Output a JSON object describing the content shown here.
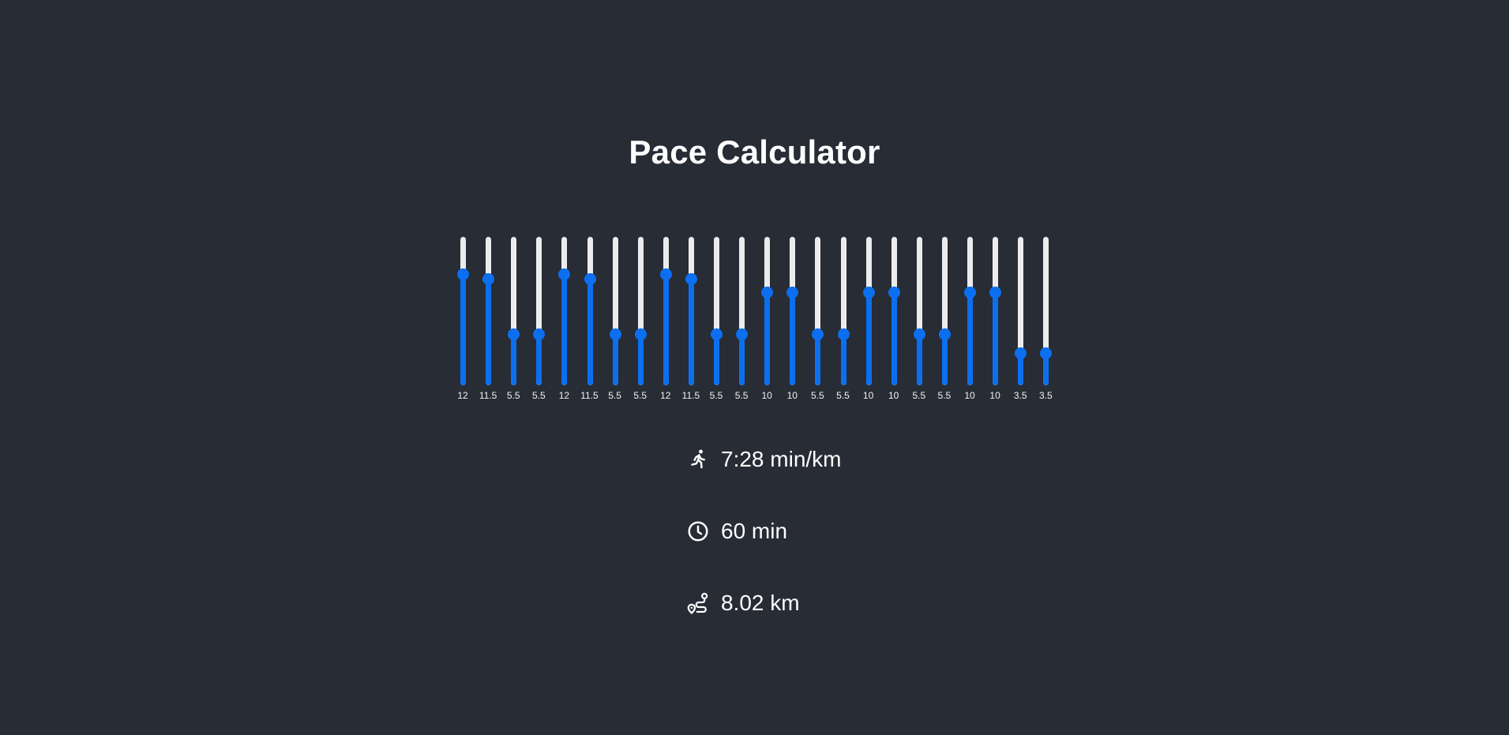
{
  "title": "Pace Calculator",
  "slider_range": [
    0,
    16
  ],
  "sliders": [
    {
      "label": "12",
      "value": 12
    },
    {
      "label": "11.5",
      "value": 11.5
    },
    {
      "label": "5.5",
      "value": 5.5
    },
    {
      "label": "5.5",
      "value": 5.5
    },
    {
      "label": "12",
      "value": 12
    },
    {
      "label": "11.5",
      "value": 11.5
    },
    {
      "label": "5.5",
      "value": 5.5
    },
    {
      "label": "5.5",
      "value": 5.5
    },
    {
      "label": "12",
      "value": 12
    },
    {
      "label": "11.5",
      "value": 11.5
    },
    {
      "label": "5.5",
      "value": 5.5
    },
    {
      "label": "5.5",
      "value": 5.5
    },
    {
      "label": "10",
      "value": 10
    },
    {
      "label": "10",
      "value": 10
    },
    {
      "label": "5.5",
      "value": 5.5
    },
    {
      "label": "5.5",
      "value": 5.5
    },
    {
      "label": "10",
      "value": 10
    },
    {
      "label": "10",
      "value": 10
    },
    {
      "label": "5.5",
      "value": 5.5
    },
    {
      "label": "5.5",
      "value": 5.5
    },
    {
      "label": "10",
      "value": 10
    },
    {
      "label": "10",
      "value": 10
    },
    {
      "label": "3.5",
      "value": 3.5
    },
    {
      "label": "3.5",
      "value": 3.5
    }
  ],
  "stats": {
    "pace": {
      "icon": "running-icon",
      "text": "7:28 min/km"
    },
    "time": {
      "icon": "clock-icon",
      "text": "60 min"
    },
    "distance": {
      "icon": "route-icon",
      "text": "8.02 km"
    }
  },
  "colors": {
    "background": "#282c35",
    "accent": "#0b6ff0",
    "track": "#ececec",
    "text": "#ffffff"
  }
}
